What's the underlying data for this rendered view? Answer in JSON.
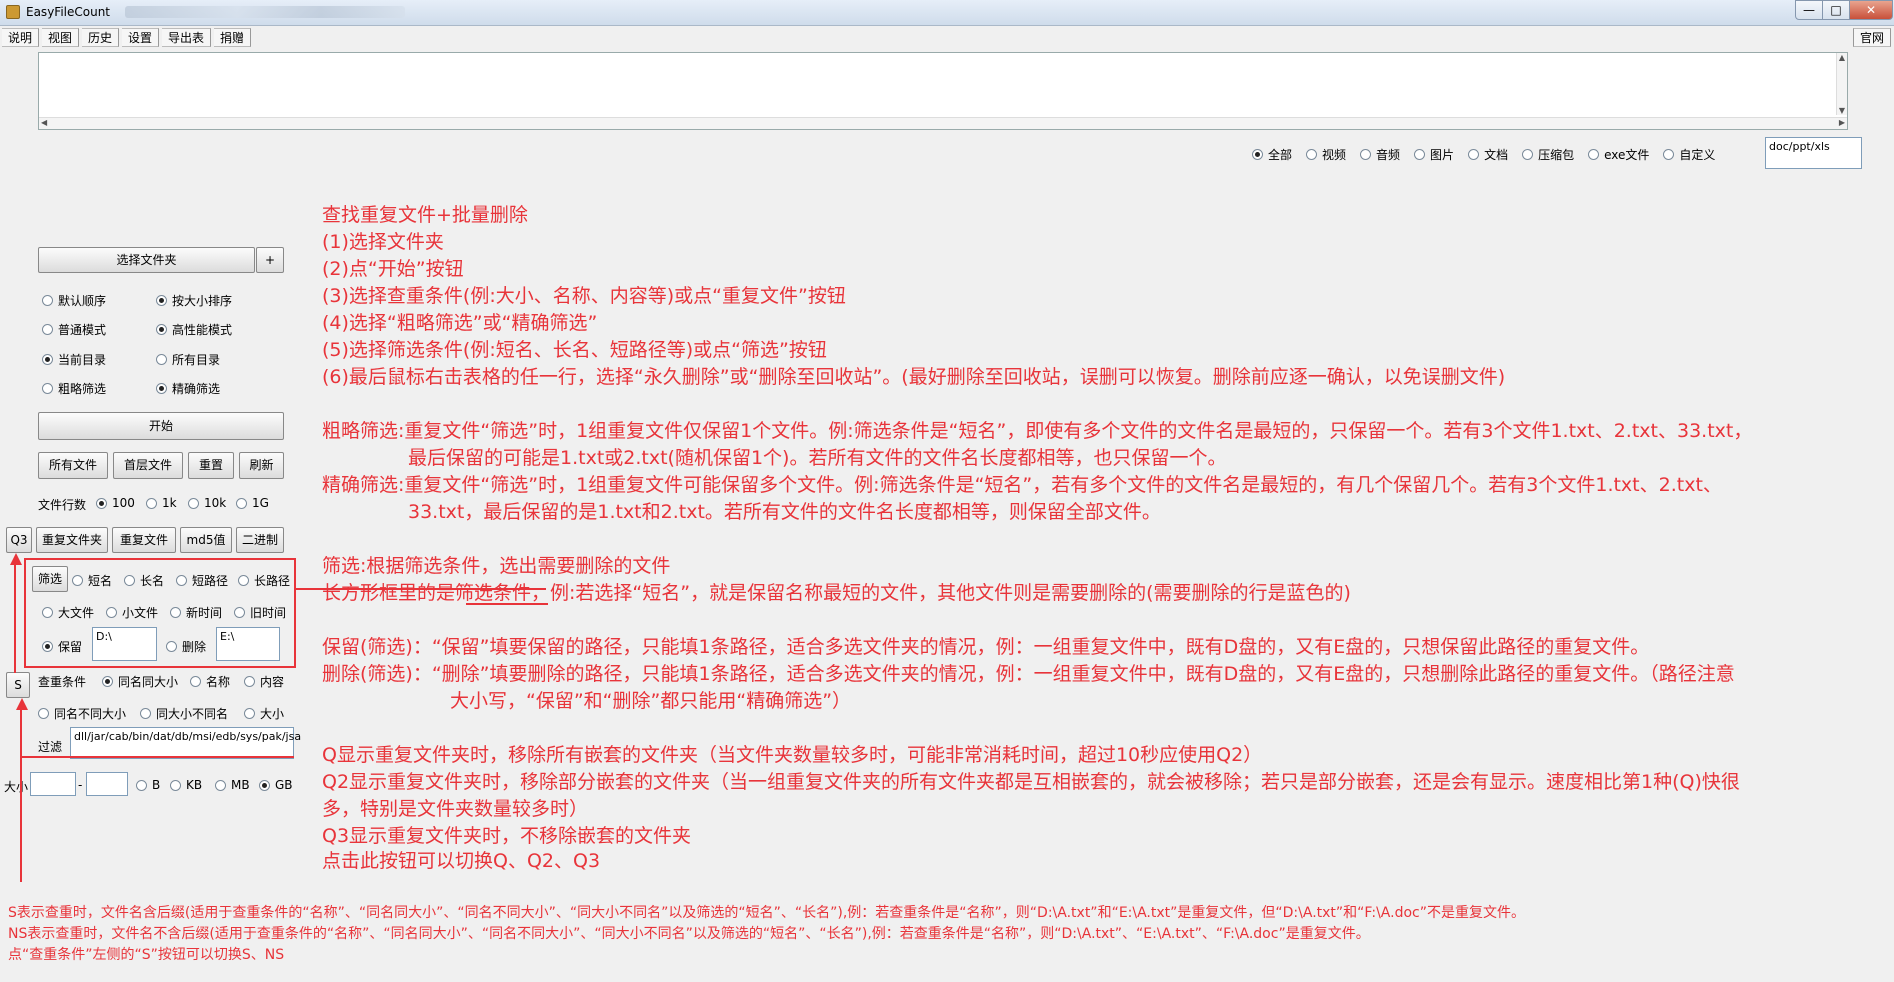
{
  "window": {
    "title": "EasyFileCount",
    "controls": {
      "minimize": "—",
      "maximize": "□",
      "close": "✕"
    }
  },
  "menu": [
    "说明",
    "视图",
    "历史",
    "设置",
    "导出表",
    "捐赠"
  ],
  "menu_right": "官网",
  "file_types": {
    "options": [
      "全部",
      "视频",
      "音频",
      "图片",
      "文档",
      "压缩包",
      "exe文件",
      "自定义"
    ],
    "selected": "全部",
    "custom_value": "doc/ppt/xls"
  },
  "left": {
    "select_folder": "选择文件夹",
    "add": "+",
    "order_options": [
      "默认顺序",
      "按大小排序"
    ],
    "order_selected": "按大小排序",
    "mode_options": [
      "普通模式",
      "高性能模式"
    ],
    "mode_selected": "高性能模式",
    "dir_options": [
      "当前目录",
      "所有目录"
    ],
    "dir_selected": "当前目录",
    "filter_options": [
      "粗略筛选",
      "精确筛选"
    ],
    "filter_selected": "精确筛选",
    "start": "开始",
    "buttons_row1": [
      "所有文件",
      "首层文件",
      "重置",
      "刷新"
    ],
    "rows_label": "文件行数",
    "rows_options": [
      "100",
      "1k",
      "10k",
      "1G"
    ],
    "rows_selected": "100",
    "q3": "Q3",
    "buttons_row2": [
      "重复文件夹",
      "重复文件",
      "md5值",
      "二进制"
    ],
    "filter_box": {
      "filter_btn": "筛选",
      "opts1": [
        "短名",
        "长名",
        "短路径",
        "长路径"
      ],
      "opts2": [
        "大文件",
        "小文件",
        "新时间",
        "旧时间"
      ],
      "keep_label": "保留",
      "keep_value": "D:\\",
      "delete_label": "删除",
      "delete_value": "E:\\"
    },
    "s_btn": "S",
    "cond_label": "查重条件",
    "cond_opts1": [
      "同名同大小",
      "名称",
      "内容"
    ],
    "cond_opts2": [
      "同名不同大小",
      "同大小不同名",
      "大小"
    ],
    "cond_selected": "同名同大小",
    "filter_label": "过滤",
    "filter_value": "dll/jar/cab/bin/dat/db/msi/edb/sys/pak/jsa",
    "size_label": "大小",
    "size_dash": "-",
    "size_units": [
      "B",
      "KB",
      "MB",
      "GB"
    ],
    "size_selected": "GB"
  },
  "notes": {
    "main": [
      "查找重复文件+批量删除",
      "(1)选择文件夹",
      "(2)点“开始”按钮",
      "(3)选择查重条件(例:大小、名称、内容等)或点“重复文件”按钮",
      "(4)选择“粗略筛选”或“精确筛选”",
      "(5)选择筛选条件(例:短名、长名、短路径等)或点“筛选”按钮",
      "(6)最后鼠标右击表格的任一行，选择“永久删除”或“删除至回收站”。(最好删除至回收站，误删可以恢复。删除前应逐一确认，以免误删文件)"
    ],
    "rough": [
      "粗略筛选:重复文件“筛选”时，1组重复文件仅保留1个文件。例:筛选条件是“短名”，即使有多个文件的文件名是最短的，只保留一个。若有3个文件1.txt、2.txt、33.txt，",
      "最后保留的可能是1.txt或2.txt(随机保留1个)。若所有文件的文件名长度都相等，也只保留一个。"
    ],
    "exact": [
      "精确筛选:重复文件“筛选”时，1组重复文件可能保留多个文件。例:筛选条件是“短名”，若有多个文件的文件名是最短的，有几个保留几个。若有3个文件1.txt、2.txt、",
      "33.txt，最后保留的是1.txt和2.txt。若所有文件的文件名长度都相等，则保留全部文件。"
    ],
    "filter": [
      "筛选:根据筛选条件，选出需要删除的文件",
      "长方形框里的是筛选条件，例:若选择“短名”，就是保留名称最短的文件，其他文件则是需要删除的(需要删除的行是蓝色的)"
    ],
    "keep": "保留(筛选)：“保留”填要保留的路径，只能填1条路径，适合多选文件夹的情况，例：一组重复文件中，既有D盘的，又有E盘的，只想保留此路径的重复文件。",
    "delete": [
      "删除(筛选)：“删除”填要删除的路径，只能填1条路径，适合多选文件夹的情况，例：一组重复文件中，既有D盘的，又有E盘的，只想删除此路径的重复文件。（路径注意",
      "大小写，“保留”和“删除”都只能用“精确筛选”）"
    ],
    "q": [
      "Q显示重复文件夹时，移除所有嵌套的文件夹（当文件夹数量较多时，可能非常消耗时间，超过10秒应使用Q2）",
      "Q2显示重复文件夹时，移除部分嵌套的文件夹（当一组重复文件夹的所有文件夹都是互相嵌套的，就会被移除；若只是部分嵌套，还是会有显示。速度相比第1种(Q)快很",
      "多，特别是文件夹数量较多时）",
      "Q3显示重复文件夹时，不移除嵌套的文件夹",
      "点击此按钮可以切换Q、Q2、Q3"
    ],
    "s": [
      "S表示查重时，文件名含后缀(适用于查重条件的“名称”、“同名同大小”、“同名不同大小”、“同大小不同名”以及筛选的“短名”、“长名”),例：若查重条件是“名称”，则“D:\\A.txt”和“E:\\A.txt”是重复文件，但“D:\\A.txt”和“F:\\A.doc”不是重复文件。",
      "NS表示查重时，文件名不含后缀(适用于查重条件的“名称”、“同名同大小”、“同名不同大小”、“同大小不同名”以及筛选的“短名”、“长名”),例：若查重条件是“名称”，则“D:\\A.txt”、“E:\\A.txt”、“F:\\A.doc”是重复文件。",
      "点“查重条件”左侧的“S”按钮可以切换S、NS"
    ]
  },
  "colors": {
    "annotation": "#e8343a",
    "box": "#e8343a"
  }
}
